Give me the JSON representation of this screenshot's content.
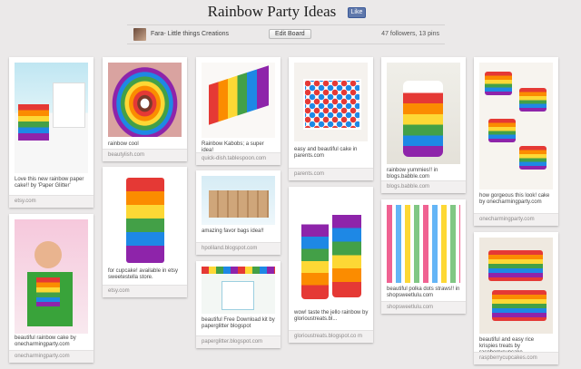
{
  "header": {
    "board_title": "Rainbow Party Ideas",
    "like_label": "Like"
  },
  "board_bar": {
    "owner": "Fara- Little things Creations",
    "edit_label": "Edit Board",
    "stats": "47 followers, 13 pins"
  },
  "pins": [
    {
      "desc": "Love this new rainbow paper cake!! by 'Paper Glitter'",
      "source": "etsy.com"
    },
    {
      "desc": "rainbow cool",
      "source": "beautylish.com"
    },
    {
      "desc": "Rainbow Kabobs; a super idea!",
      "source": "quick-dish.tablespoon.com"
    },
    {
      "desc": "easy and beautiful cake in parents.com",
      "source": "parents.com"
    },
    {
      "desc": "rainbow yummies!! in blogs.babble.com",
      "source": "blogs.babble.com"
    },
    {
      "desc": "how gorgeous this look! cake by onecharmingparty.com",
      "source": "onecharmingparty.com"
    },
    {
      "desc": "beautiful rainbow cake by onecharmingparty.com",
      "source": "onecharmingparty.com"
    },
    {
      "desc": "for cupcake! available in etsy sweetestella store.",
      "source": "etsy.com"
    },
    {
      "desc": "amazing favor bags idea!!",
      "source": "hpoliland.blogspot.com"
    },
    {
      "desc": "beautiful Free Download kit by paperglitter blogspot",
      "source": "paperglitter.blogspot.com"
    },
    {
      "desc": "wow! taste the jello rainbow by glorioustreats.bl...",
      "source": "glorioustreats.blogspot.co m"
    },
    {
      "desc": "beautiful polka dots straws!! in shopsweetlulu.com",
      "source": "shopsweetlulu.com"
    },
    {
      "desc": "beautiful and easy rice krispies treats by raspberrycupcake...",
      "source": "raspberrycupcakes.com"
    }
  ]
}
